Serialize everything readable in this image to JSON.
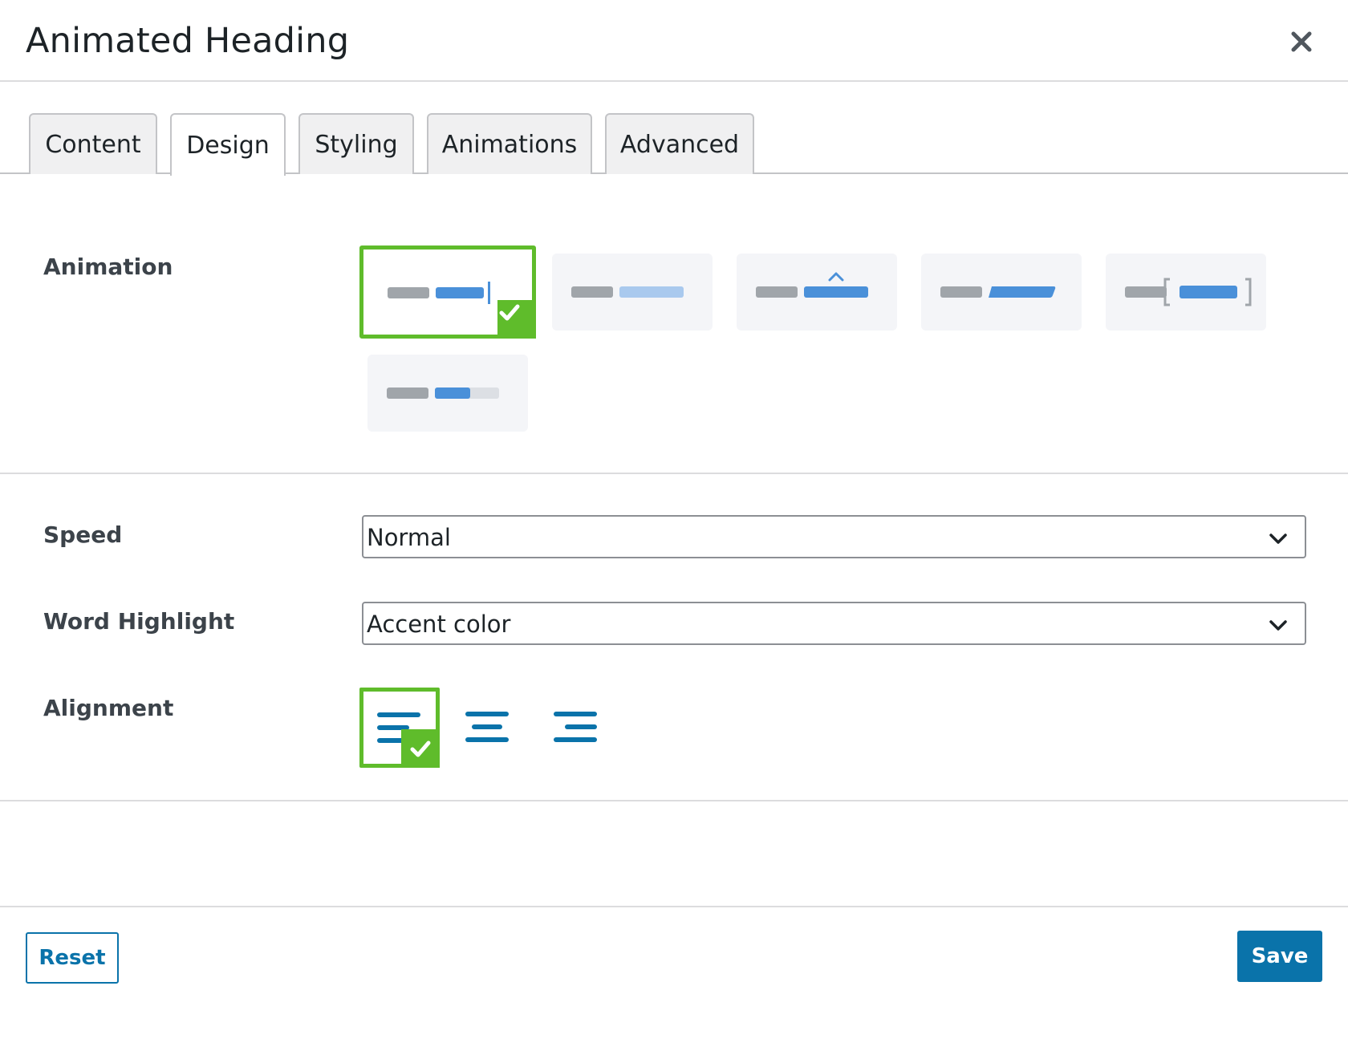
{
  "dialog": {
    "title": "Animated Heading"
  },
  "tabs": [
    {
      "label": "Content",
      "active": false
    },
    {
      "label": "Design",
      "active": true
    },
    {
      "label": "Styling",
      "active": false
    },
    {
      "label": "Animations",
      "active": false
    },
    {
      "label": "Advanced",
      "active": false
    }
  ],
  "animation": {
    "label": "Animation",
    "selected_index": 0,
    "options": [
      "typing-icon",
      "fade-icon",
      "bounce-icon",
      "slide-icon",
      "bracket-icon",
      "progress-icon"
    ]
  },
  "speed": {
    "label": "Speed",
    "value": "Normal"
  },
  "word_highlight": {
    "label": "Word Highlight",
    "value": "Accent color"
  },
  "alignment": {
    "label": "Alignment",
    "selected": "left",
    "options": [
      "align-left-icon",
      "align-center-icon",
      "align-right-icon"
    ]
  },
  "footer": {
    "reset_label": "Reset",
    "save_label": "Save"
  },
  "colors": {
    "accent": "#0a73aa",
    "selected_border": "#5fbc2b",
    "bar_gray": "#a0a5aa",
    "bar_blue": "#4a90d9",
    "bar_light_blue": "#a9c9ee"
  }
}
